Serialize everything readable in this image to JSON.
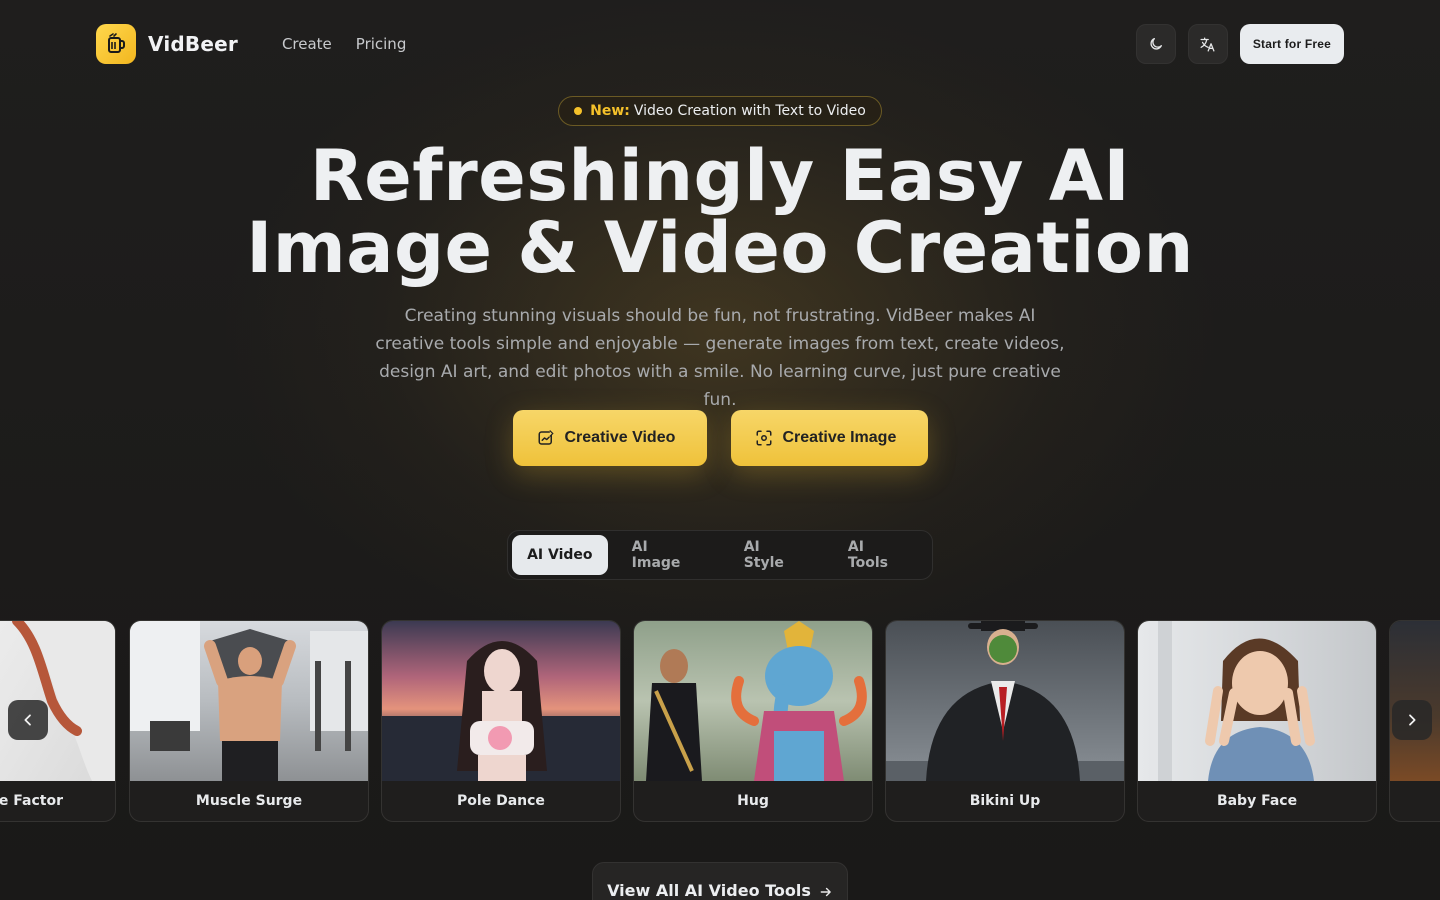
{
  "header": {
    "brand": "VidBeer",
    "logo_icon": "pouring-beer-icon",
    "nav": [
      {
        "label": "Create"
      },
      {
        "label": "Pricing"
      }
    ],
    "theme_icon": "moon-icon",
    "language_icon": "translate-icon",
    "start_label": "Start for Free"
  },
  "badge": {
    "prefix": "New:",
    "text": "Video Creation with Text to Video"
  },
  "hero": {
    "title_line1": "Refreshingly Easy AI",
    "title_line2": "Image & Video Creation",
    "subtitle": "Creating stunning visuals should be fun, not frustrating. VidBeer makes AI creative tools simple and enjoyable — generate images from text, create videos, design AI art, and edit photos with a smile. No learning curve, just pure creative fun.",
    "cta_video": "Creative Video",
    "cta_image": "Creative Image"
  },
  "tabs": [
    {
      "label": "AI Video",
      "active": true
    },
    {
      "label": "AI Image",
      "active": false
    },
    {
      "label": "AI Style",
      "active": false
    },
    {
      "label": "AI Tools",
      "active": false
    }
  ],
  "carousel": {
    "cards": [
      {
        "label": "e Factor"
      },
      {
        "label": "Muscle Surge"
      },
      {
        "label": "Pole Dance"
      },
      {
        "label": "Hug"
      },
      {
        "label": "Bikini Up"
      },
      {
        "label": "Baby Face"
      },
      {
        "label": ""
      }
    ],
    "prev_icon": "chevron-left-icon",
    "next_icon": "chevron-right-icon"
  },
  "view_all": {
    "label": "View All AI Video Tools",
    "icon": "arrow-right-icon"
  },
  "colors": {
    "accent": "#f5c12a",
    "cta_gradient_top": "#f7d668",
    "cta_gradient_bottom": "#efc23a",
    "background": "#1d1c1b"
  }
}
